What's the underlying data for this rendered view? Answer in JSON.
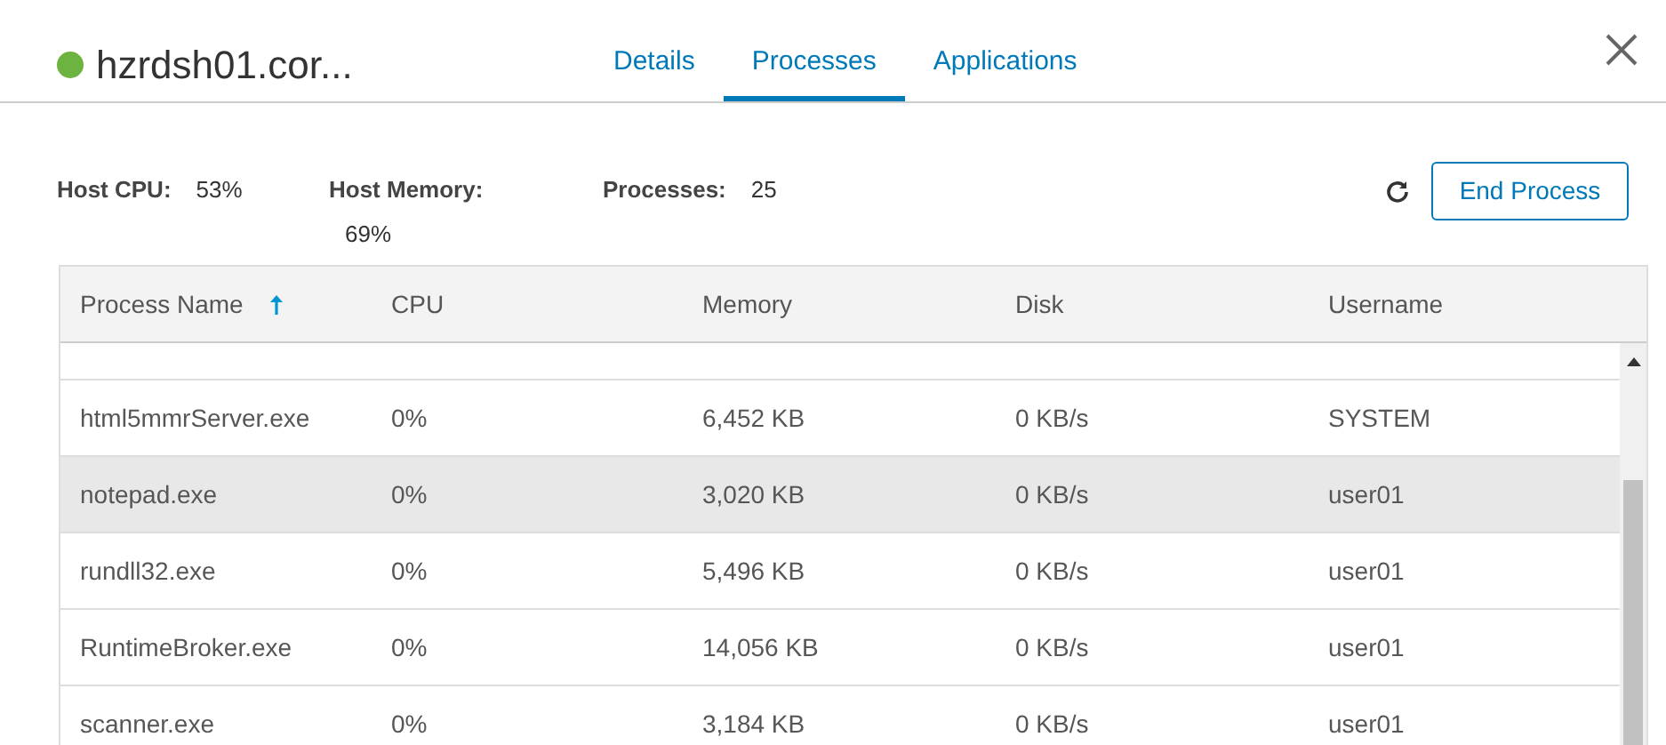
{
  "header": {
    "title": "hzrdsh01.cor...",
    "online": true
  },
  "tabs": [
    {
      "label": "Details",
      "selected": false
    },
    {
      "label": "Processes",
      "selected": true
    },
    {
      "label": "Applications",
      "selected": false
    }
  ],
  "stats": [
    {
      "label": "Host CPU:",
      "value": "53%"
    },
    {
      "label": "Host Memory:",
      "value": "69%"
    },
    {
      "label": "Processes:",
      "value": "25"
    }
  ],
  "end_button": "End Process",
  "table": {
    "columns": [
      {
        "label": "Process Name",
        "sorted": true
      },
      {
        "label": "CPU",
        "sorted": false
      },
      {
        "label": "Memory",
        "sorted": false
      },
      {
        "label": "Disk",
        "sorted": false
      },
      {
        "label": "Username",
        "sorted": false
      }
    ],
    "rows": [
      {
        "cells": [
          "html5mmrServer.exe",
          "0%",
          "6,452 KB",
          "0 KB/s",
          "SYSTEM"
        ],
        "selected": false
      },
      {
        "cells": [
          "notepad.exe",
          "0%",
          "3,020 KB",
          "0 KB/s",
          "user01"
        ],
        "selected": true
      },
      {
        "cells": [
          "rundll32.exe",
          "0%",
          "5,496 KB",
          "0 KB/s",
          "user01"
        ],
        "selected": false
      },
      {
        "cells": [
          "RuntimeBroker.exe",
          "0%",
          "14,056 KB",
          "0 KB/s",
          "user01"
        ],
        "selected": false
      },
      {
        "cells": [
          "scanner.exe",
          "0%",
          "3,184 KB",
          "0 KB/s",
          "user01"
        ],
        "selected": false
      }
    ]
  }
}
